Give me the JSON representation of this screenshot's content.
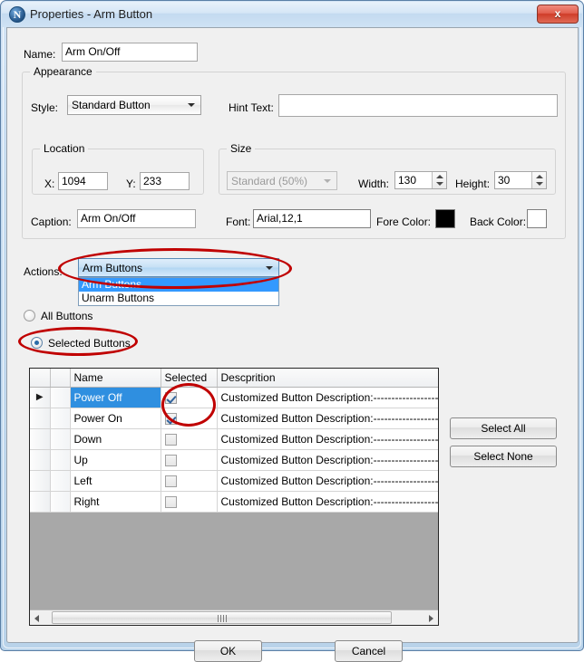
{
  "window": {
    "title": "Properties - Arm Button",
    "icon": "app-n-icon",
    "close_label": "x"
  },
  "form": {
    "name_label": "Name:",
    "name_value": "Arm On/Off",
    "appearance_group": "Appearance",
    "style_label": "Style:",
    "style_value": "Standard Button",
    "style_options": [
      "Standard Button"
    ],
    "hint_label": "Hint Text:",
    "hint_value": "",
    "hint_placeholder": "",
    "location_group": "Location",
    "x_label": "X:",
    "x_value": "1094",
    "y_label": "Y:",
    "y_value": "233",
    "size_group": "Size",
    "size_value": "Standard   (50%)",
    "width_label": "Width:",
    "width_value": "130",
    "height_label": "Height:",
    "height_value": "30",
    "caption_label": "Caption:",
    "caption_value": "Arm On/Off",
    "font_label": "Font:",
    "font_value": "Arial,12,1",
    "fore_color_label": "Fore Color:",
    "fore_color_value": "#000000",
    "back_color_label": "Back Color:",
    "back_color_value": "#ffffff"
  },
  "actions": {
    "label": "Actions:",
    "selected_value": "Arm Buttons",
    "options": [
      {
        "label": "Arm Buttons",
        "selected": true
      },
      {
        "label": "Unarm Buttons",
        "selected": false
      }
    ]
  },
  "scope": {
    "all_buttons_label": "All Buttons",
    "all_buttons_checked": false,
    "selected_buttons_label": "Selected Buttons",
    "selected_buttons_checked": true
  },
  "grid": {
    "columns": [
      "",
      "",
      "Name",
      "Selected",
      "Descprition"
    ],
    "rows": [
      {
        "indicator": "▶",
        "name": "Power Off",
        "selected": true,
        "description": "Customized Button Description:--------------------Name:",
        "row_selected": true
      },
      {
        "indicator": "",
        "name": "Power On",
        "selected": true,
        "description": "Customized Button Description:--------------------Name:",
        "row_selected": false
      },
      {
        "indicator": "",
        "name": "Down",
        "selected": false,
        "description": "Customized Button Description:--------------------Name:",
        "row_selected": false
      },
      {
        "indicator": "",
        "name": "Up",
        "selected": false,
        "description": "Customized Button Description:--------------------Name:",
        "row_selected": false
      },
      {
        "indicator": "",
        "name": "Left",
        "selected": false,
        "description": "Customized Button Description:--------------------Name:",
        "row_selected": false
      },
      {
        "indicator": "",
        "name": "Right",
        "selected": false,
        "description": "Customized Button Description:--------------------Name:",
        "row_selected": false
      }
    ]
  },
  "side_buttons": {
    "select_all": "Select All",
    "select_none": "Select None"
  },
  "footer": {
    "ok": "OK",
    "cancel": "Cancel"
  },
  "annotation_color": "#c00000"
}
